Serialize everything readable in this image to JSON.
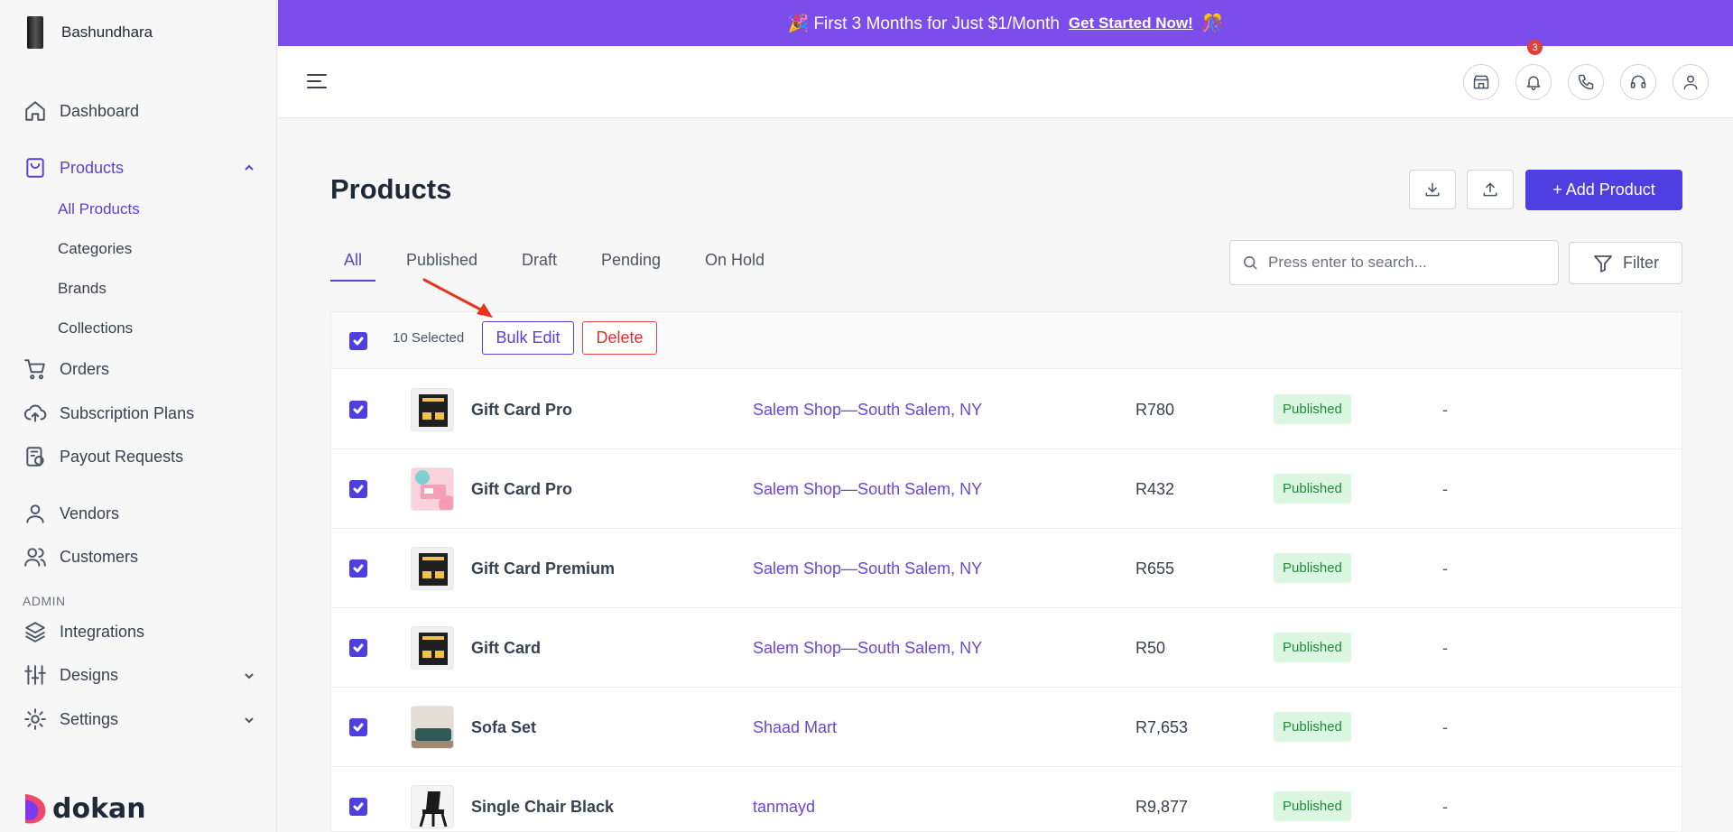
{
  "store": {
    "name": "Bashundhara"
  },
  "sidebar": {
    "items": [
      {
        "label": "Dashboard",
        "icon": "home-icon"
      },
      {
        "label": "Products",
        "icon": "shopping-bag-icon"
      },
      {
        "label": "Orders",
        "icon": "cart-icon"
      },
      {
        "label": "Subscription Plans",
        "icon": "cloud-upload-icon"
      },
      {
        "label": "Payout Requests",
        "icon": "payout-icon"
      },
      {
        "label": "Vendors",
        "icon": "user-icon"
      },
      {
        "label": "Customers",
        "icon": "users-icon"
      },
      {
        "label": "Integrations",
        "icon": "layers-icon"
      },
      {
        "label": "Designs",
        "icon": "sliders-icon"
      },
      {
        "label": "Settings",
        "icon": "gear-icon"
      }
    ],
    "product_sub": [
      "All Products",
      "Categories",
      "Brands",
      "Collections"
    ],
    "section_admin": "ADMIN",
    "footer_logo": "dokan"
  },
  "promo": {
    "text": "🎉 First 3 Months for Just $1/Month",
    "cta": "Get Started Now!",
    "trail": "🎊"
  },
  "header": {
    "notification_count": "3"
  },
  "main": {
    "title": "Products",
    "add_button": "+ Add Product",
    "tabs": [
      "All",
      "Published",
      "Draft",
      "Pending",
      "On Hold"
    ],
    "active_tab": "All",
    "search": {
      "placeholder": "Press enter to search...",
      "value": ""
    },
    "filter_label": "Filter",
    "bulk": {
      "selected": "10 Selected",
      "edit": "Bulk Edit",
      "delete": "Delete"
    },
    "rows": [
      {
        "name": "Gift Card Pro",
        "vendor": "Salem Shop—South Salem, NY",
        "price": "R780",
        "status": "Published",
        "extra": "-"
      },
      {
        "name": "Gift Card Pro",
        "vendor": "Salem Shop—South Salem, NY",
        "price": "R432",
        "status": "Published",
        "extra": "-"
      },
      {
        "name": "Gift Card Premium",
        "vendor": "Salem Shop—South Salem, NY",
        "price": "R655",
        "status": "Published",
        "extra": "-"
      },
      {
        "name": "Gift Card",
        "vendor": "Salem Shop—South Salem, NY",
        "price": "R50",
        "status": "Published",
        "extra": "-"
      },
      {
        "name": "Sofa Set",
        "vendor": "Shaad Mart",
        "price": "R7,653",
        "status": "Published",
        "extra": "-"
      },
      {
        "name": "Single Chair Black",
        "vendor": "tanmayd",
        "price": "R9,877",
        "status": "Published",
        "extra": "-"
      }
    ]
  },
  "colors": {
    "accent": "#4f3fe0",
    "promo": "#7c4dea",
    "danger": "#d63333",
    "success_bg": "#dcf7e1"
  }
}
